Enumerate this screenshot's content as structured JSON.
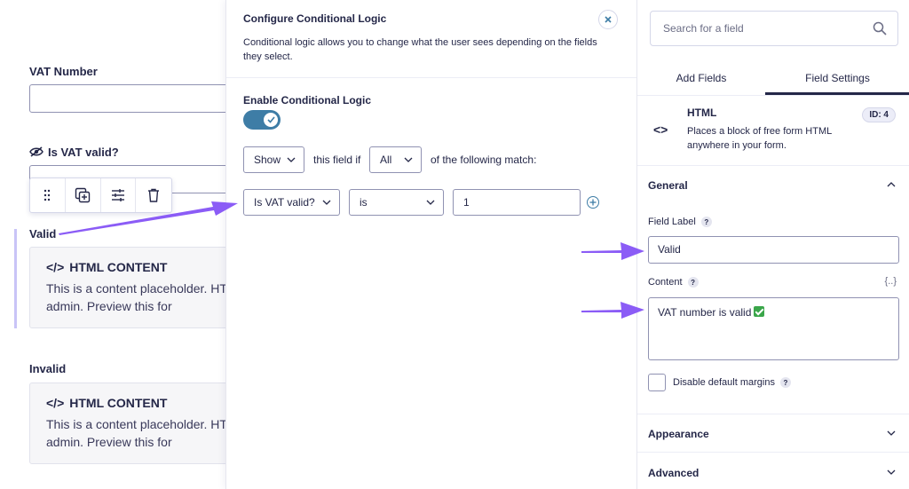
{
  "canvas": {
    "vat_number_label": "VAT Number",
    "is_vat_valid_label": "Is VAT valid?",
    "valid_label": "Valid",
    "invalid_label": "Invalid",
    "html_block_title": "HTML CONTENT",
    "html_block_text": "This is a content placeholder. HTML content is not displayed in the form admin. Preview this form to view the content.",
    "html_block_text_visible": "This is a content placeholder. HT the form admin. Preview this for"
  },
  "logic_panel": {
    "title": "Configure Conditional Logic",
    "description": "Conditional logic allows you to change what the user sees depending on the fields they select.",
    "enable_label": "Enable Conditional Logic",
    "enabled": true,
    "action_select": "Show",
    "text_this_field_if": "this field if",
    "match_select": "All",
    "text_following_match": "of the following match:",
    "rule": {
      "field": "Is VAT valid?",
      "operator": "is",
      "value": "1"
    }
  },
  "sidebar": {
    "search_placeholder": "Search for a field",
    "tabs": [
      "Add Fields",
      "Field Settings"
    ],
    "active_tab": "Field Settings",
    "field": {
      "type_name": "HTML",
      "type_description": "Places a block of free form HTML anywhere in your form.",
      "id_badge": "ID: 4",
      "icon": "code-icon"
    },
    "general": {
      "title": "General",
      "field_label_label": "Field Label",
      "field_label_value": "Valid",
      "content_label": "Content",
      "content_value": "VAT number is valid",
      "merge_tag_glyph": "{..}",
      "disable_margins_label": "Disable default margins",
      "disable_margins_checked": false
    },
    "appearance_title": "Appearance",
    "advanced_title": "Advanced"
  },
  "colors": {
    "accent_blue": "#3e7da6",
    "arrow_purple": "#8b5cf6",
    "text_dark": "#242748",
    "success_green": "#3aa64a"
  }
}
